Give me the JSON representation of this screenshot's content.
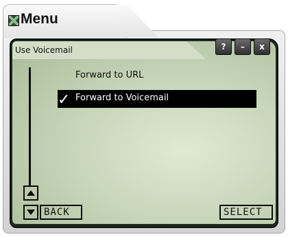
{
  "window": {
    "title": "Menu",
    "controls": {
      "help_label": "?",
      "minimize_label": "–",
      "close_label": "x"
    }
  },
  "screen": {
    "header": "Use Voicemail",
    "options": [
      {
        "label": "Forward to URL",
        "selected": false
      },
      {
        "label": "Forward to Voicemail",
        "selected": true
      }
    ],
    "check_glyph": "✓"
  },
  "softkeys": {
    "left": "BACK",
    "right": "SELECT"
  },
  "icons": {
    "app": "app-logo-icon",
    "scroll_up": "scroll-up-icon",
    "scroll_down": "scroll-down-icon"
  },
  "colors": {
    "screen_bg": "#c8d6ba",
    "highlight": "#000000",
    "bezel": "#1f2a1f"
  }
}
